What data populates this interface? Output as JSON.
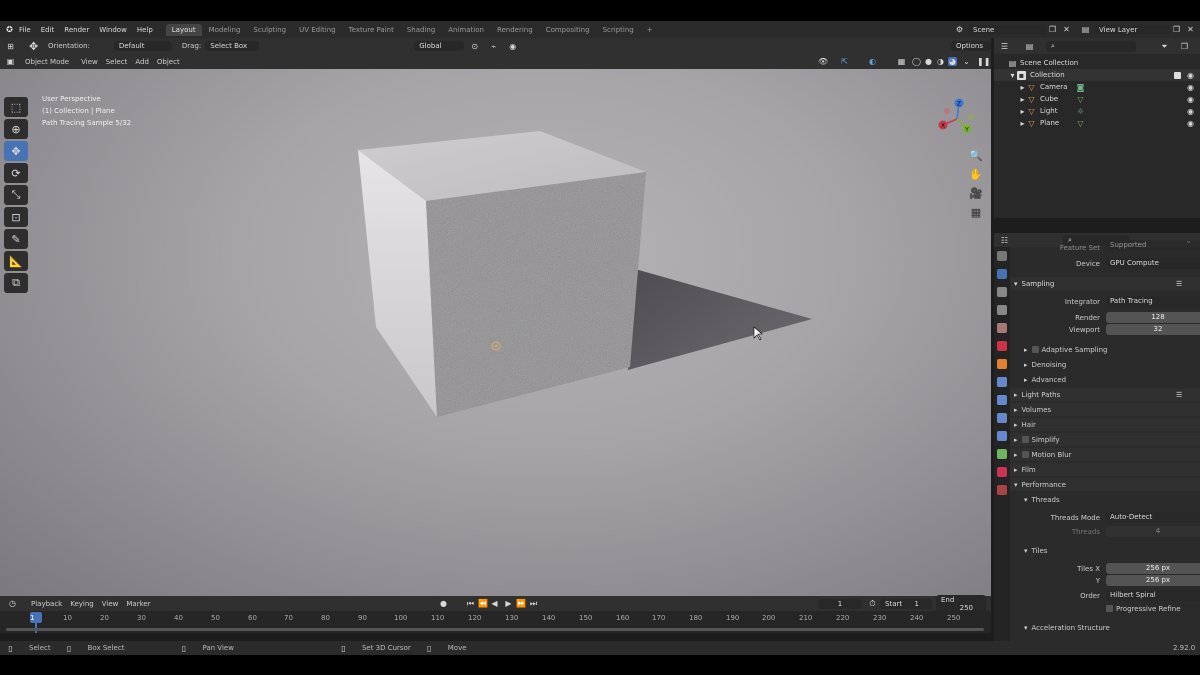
{
  "menu": [
    "File",
    "Edit",
    "Render",
    "Window",
    "Help"
  ],
  "workspaces": [
    "Layout",
    "Modeling",
    "Sculpting",
    "UV Editing",
    "Texture Paint",
    "Shading",
    "Animation",
    "Rendering",
    "Compositing",
    "Scripting"
  ],
  "scene": "Scene",
  "view_layer": "View Layer",
  "header": {
    "orientation_label": "Orientation:",
    "orientation_value": "Default",
    "drag_label": "Drag:",
    "drag_value": "Select Box",
    "transform": "Global",
    "options": "Options"
  },
  "view_menu": {
    "mode": "Object Mode",
    "items": [
      "View",
      "Select",
      "Add",
      "Object"
    ]
  },
  "overlay": {
    "line1": "User Perspective",
    "line2": "(1) Collection | Plane",
    "line3": "Path Tracing Sample 5/32"
  },
  "gizmo": {
    "x": "X",
    "y": "Y",
    "z": "Z"
  },
  "timeline": {
    "items": [
      "Playback",
      "Keying",
      "View",
      "Marker"
    ],
    "current_frame": "1",
    "start_label": "Start",
    "start": "1",
    "end_label": "End",
    "end": "250"
  },
  "ruler": [
    "1",
    "10",
    "20",
    "30",
    "40",
    "50",
    "60",
    "70",
    "80",
    "90",
    "100",
    "110",
    "120",
    "130",
    "140",
    "150",
    "160",
    "170",
    "180",
    "190",
    "200",
    "210",
    "220",
    "230",
    "240",
    "250"
  ],
  "status": {
    "select": "Select",
    "box_select": "Box Select",
    "pan_view": "Pan View",
    "cursor": "Set 3D Cursor",
    "move": "Move",
    "version": "2.92.0"
  },
  "outliner": {
    "root": "Scene Collection",
    "collection": "Collection",
    "items": [
      "Camera",
      "Cube",
      "Light",
      "Plane"
    ]
  },
  "properties": {
    "feature_set_label": "Feature Set",
    "feature_set_value": "Supported",
    "device_label": "Device",
    "device_value": "GPU Compute",
    "sampling": "Sampling",
    "integrator_label": "Integrator",
    "integrator_value": "Path Tracing",
    "render_label": "Render",
    "render_value": "128",
    "viewport_label": "Viewport",
    "viewport_value": "32",
    "adaptive": "Adaptive Sampling",
    "denoising": "Denoising",
    "advanced": "Advanced",
    "light_paths": "Light Paths",
    "volumes": "Volumes",
    "hair": "Hair",
    "simplify": "Simplify",
    "motion_blur": "Motion Blur",
    "film": "Film",
    "performance": "Performance",
    "threads": "Threads",
    "threads_mode_label": "Threads Mode",
    "threads_mode_value": "Auto-Detect",
    "threads_label": "Threads",
    "threads_value": "4",
    "tiles": "Tiles",
    "tiles_x_label": "Tiles X",
    "tiles_x_value": "256 px",
    "tiles_y_label": "Y",
    "tiles_y_value": "256 px",
    "order_label": "Order",
    "order_value": "Hilbert Spiral",
    "progressive": "Progressive Refine",
    "accel": "Acceleration Structure"
  }
}
